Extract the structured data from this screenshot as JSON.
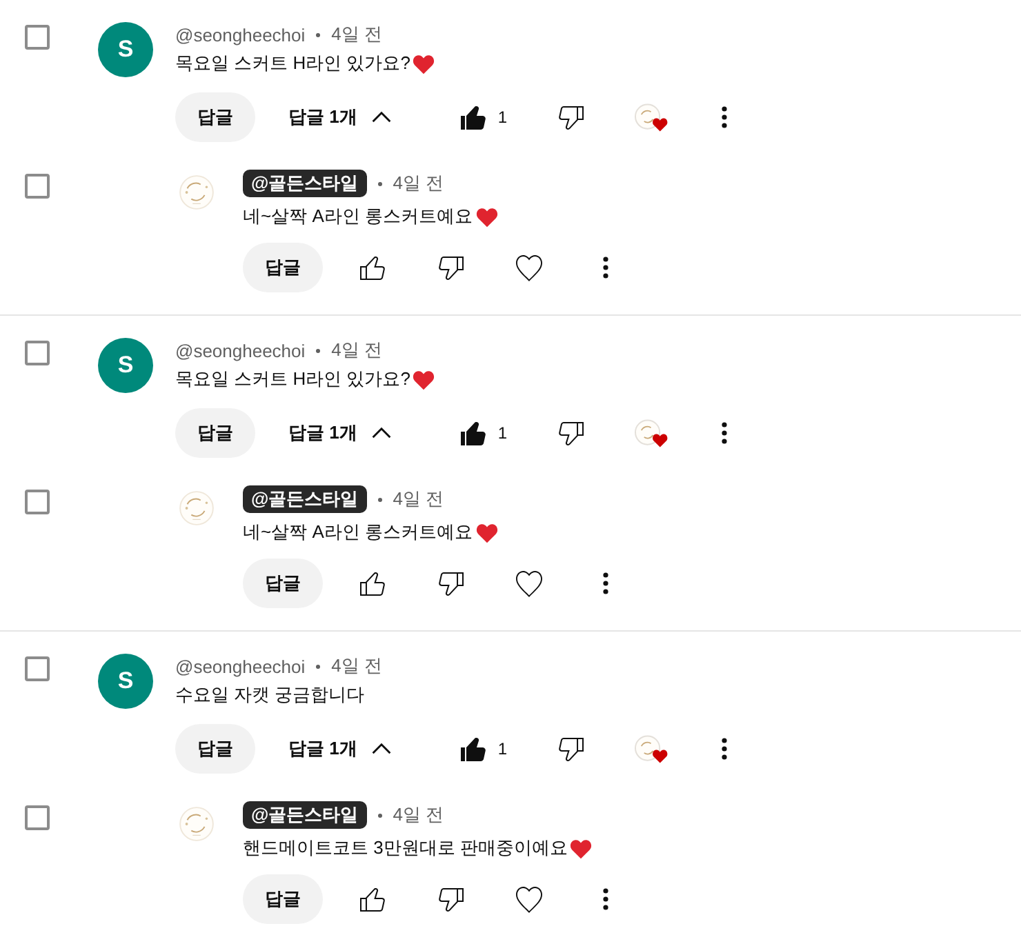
{
  "threads": [
    {
      "comment": {
        "checked": false,
        "avatar": {
          "kind": "letter",
          "letter": "S"
        },
        "author": "@seongheechoi",
        "owner": false,
        "time": "4일 전",
        "text": "목요일 스커트 H라인 있가요?",
        "heart_emoji": true,
        "reply_button": "답글",
        "replies_toggle": {
          "label": "답글 1개",
          "expanded": true
        },
        "liked": true,
        "like_count": "1",
        "creator_hearted": true
      },
      "replies": [
        {
          "checked": false,
          "avatar": {
            "kind": "logo"
          },
          "author": "@골든스타일",
          "owner": true,
          "time": "4일 전",
          "text": "네~살짝 A라인 롱스커트예요",
          "heart_emoji": true,
          "reply_button": "답글",
          "liked": false,
          "creator_hearted": false
        }
      ]
    },
    {
      "comment": {
        "checked": false,
        "avatar": {
          "kind": "letter",
          "letter": "S"
        },
        "author": "@seongheechoi",
        "owner": false,
        "time": "4일 전",
        "text": "목요일 스커트 H라인 있가요?",
        "heart_emoji": true,
        "reply_button": "답글",
        "replies_toggle": {
          "label": "답글 1개",
          "expanded": true
        },
        "liked": true,
        "like_count": "1",
        "creator_hearted": true
      },
      "replies": [
        {
          "checked": false,
          "avatar": {
            "kind": "logo"
          },
          "author": "@골든스타일",
          "owner": true,
          "time": "4일 전",
          "text": "네~살짝 A라인 롱스커트예요",
          "heart_emoji": true,
          "reply_button": "답글",
          "liked": false,
          "creator_hearted": false
        }
      ]
    },
    {
      "comment": {
        "checked": false,
        "avatar": {
          "kind": "letter",
          "letter": "S"
        },
        "author": "@seongheechoi",
        "owner": false,
        "time": "4일 전",
        "text": "수요일 자캣 궁금합니다",
        "heart_emoji": false,
        "reply_button": "답글",
        "replies_toggle": {
          "label": "답글 1개",
          "expanded": true
        },
        "liked": true,
        "like_count": "1",
        "creator_hearted": true
      },
      "replies": [
        {
          "checked": false,
          "avatar": {
            "kind": "logo"
          },
          "author": "@골든스타일",
          "owner": true,
          "time": "4일 전",
          "text": "핸드메이트코트 3만원대로 판매중이예요",
          "heart_emoji": true,
          "reply_button": "답글",
          "liked": false,
          "creator_hearted": false
        }
      ]
    }
  ]
}
